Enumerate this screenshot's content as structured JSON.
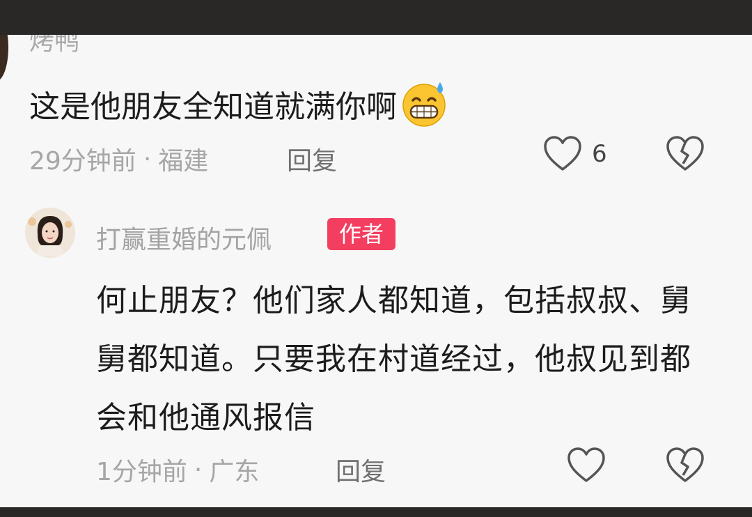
{
  "comment1": {
    "author_partial": "烤鸭",
    "text": "这是他朋友全知道就满你啊",
    "emoji": "grinning-sweat-emoji",
    "time": "29分钟前",
    "location": "福建",
    "separator": "·",
    "reply_label": "回复",
    "like_count": "6"
  },
  "comment2": {
    "author": "打赢重婚的元佩",
    "badge": "作者",
    "text": "何止朋友？他们家人都知道，包括叔叔、舅舅都知道。只要我在村道经过，他叔见到都会和他通风报信",
    "time": "1分钟前",
    "location": "广东",
    "separator": "·",
    "reply_label": "回复"
  },
  "colors": {
    "badge_bg": "#f33e60",
    "meta_text": "#a6a6a6",
    "body_text": "#1c1c1c",
    "icon_stroke": "#555555",
    "page_bg": "#f7f7f7"
  },
  "icons": [
    "heart-outline-icon",
    "broken-heart-icon"
  ]
}
